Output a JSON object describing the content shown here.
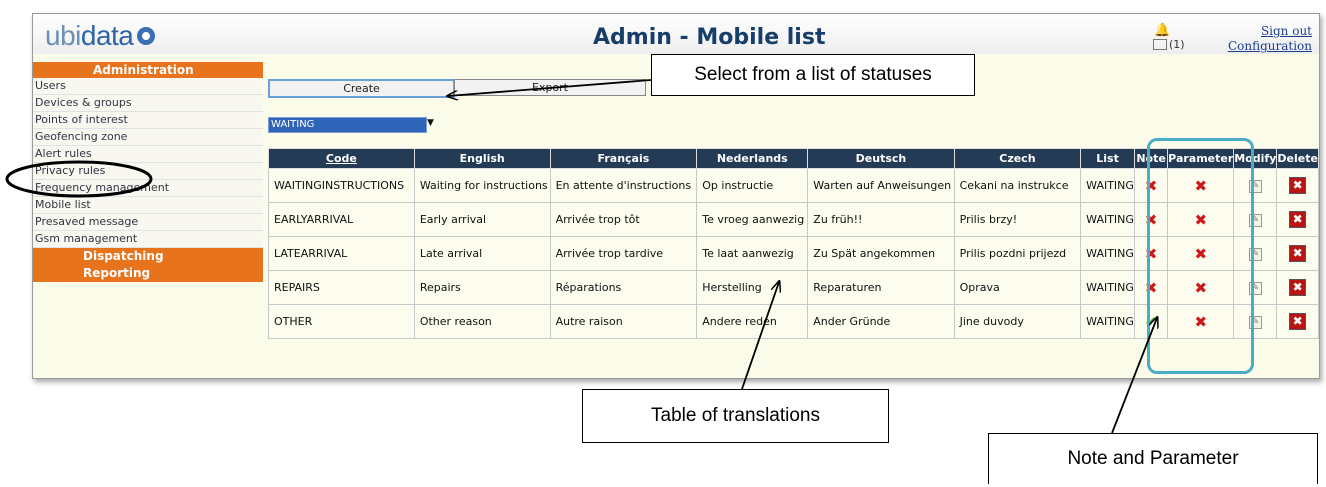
{
  "header": {
    "logo_prefix": "ubi",
    "logo_suffix": "data",
    "title": "Admin - Mobile list",
    "notification_count": "(1)",
    "sign_out": "Sign out",
    "configuration": "Configuration"
  },
  "sidebar": {
    "section_title": "Administration",
    "items": [
      {
        "label": "Users"
      },
      {
        "label": "Devices & groups"
      },
      {
        "label": "Points of interest"
      },
      {
        "label": "Geofencing zone"
      },
      {
        "label": "Alert rules"
      },
      {
        "label": "Privacy rules"
      },
      {
        "label": "Frequency management"
      },
      {
        "label": "Mobile list"
      },
      {
        "label": "Presaved message"
      },
      {
        "label": "Gsm management"
      }
    ],
    "dispatching": "Dispatching",
    "reporting": "Reporting"
  },
  "toolbar": {
    "create_label": "Create",
    "export_label": "Export"
  },
  "filter": {
    "selected_status": "WAITING"
  },
  "table": {
    "headers": [
      "Code",
      "English",
      "Français",
      "Nederlands",
      "Deutsch",
      "Czech",
      "List",
      "Note",
      "Parameter",
      "Modify",
      "Delete"
    ],
    "rows": [
      {
        "code": "WAITINGINSTRUCTIONS",
        "english": "Waiting for instructions",
        "french": "En attente d'instructions",
        "dutch": "Op instructie",
        "german": "Warten auf Anweisungen",
        "czech": "Cekani na instrukce",
        "list": "WAITING",
        "note": false,
        "parameter": false
      },
      {
        "code": "EARLYARRIVAL",
        "english": "Early arrival",
        "french": "Arrivée trop tôt",
        "dutch": "Te vroeg aanwezig",
        "german": "Zu früh!!",
        "czech": "Prilis brzy!",
        "list": "WAITING",
        "note": false,
        "parameter": false
      },
      {
        "code": "LATEARRIVAL",
        "english": "Late arrival",
        "french": "Arrivée trop tardive",
        "dutch": "Te laat aanwezig",
        "german": "Zu Spät angekommen",
        "czech": "Prilis pozdni prijezd",
        "list": "WAITING",
        "note": false,
        "parameter": false
      },
      {
        "code": "REPAIRS",
        "english": "Repairs",
        "french": "Réparations",
        "dutch": "Herstelling",
        "german": "Reparaturen",
        "czech": "Oprava",
        "list": "WAITING",
        "note": false,
        "parameter": false
      },
      {
        "code": "OTHER",
        "english": "Other reason",
        "french": "Autre raison",
        "dutch": "Andere reden",
        "german": "Ander Gründe",
        "czech": "Jine duvody",
        "list": "WAITING",
        "note": true,
        "parameter": false
      }
    ]
  },
  "annotations": {
    "select_callout": "Select from a list of statuses",
    "table_callout": "Table of translations",
    "note_param_callout": "Note and Parameter"
  },
  "colors": {
    "sidebar_header": "#e7731c",
    "table_header": "#243b55",
    "highlight": "#4bacc6",
    "select_bg": "#2f64b8"
  }
}
